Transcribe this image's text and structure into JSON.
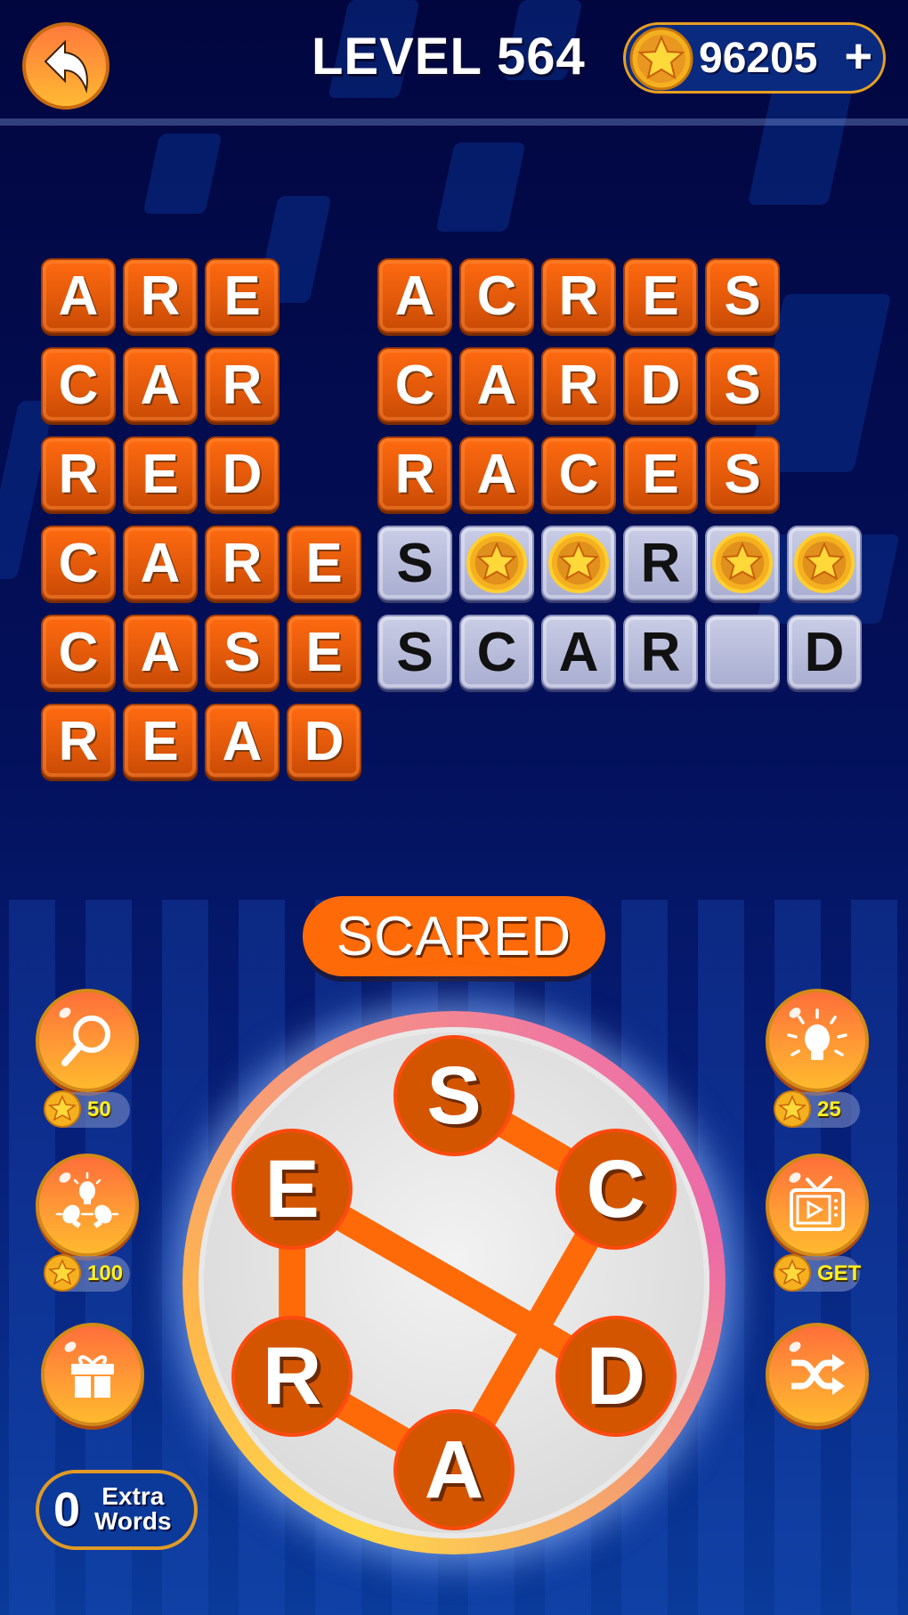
{
  "header": {
    "level_label": "LEVEL 564",
    "coins": "96205",
    "add_coins_symbol": "+",
    "back_icon": "back-arrow-icon"
  },
  "colors": {
    "tile_solved": "#ff6a10",
    "tile_empty": "#bfc3e0",
    "accent_orange": "#ff6a08",
    "coin_gold": "#f5b020",
    "cost_text": "#ffef22",
    "background_dark": "#01063f"
  },
  "board": {
    "left_column": [
      {
        "word": "ARE",
        "letters": [
          "A",
          "R",
          "E"
        ],
        "state": "solved"
      },
      {
        "word": "CAR",
        "letters": [
          "C",
          "A",
          "R"
        ],
        "state": "solved"
      },
      {
        "word": "RED",
        "letters": [
          "R",
          "E",
          "D"
        ],
        "state": "solved"
      },
      {
        "word": "CARE",
        "letters": [
          "C",
          "A",
          "R",
          "E"
        ],
        "state": "solved"
      },
      {
        "word": "CASE",
        "letters": [
          "C",
          "A",
          "S",
          "E"
        ],
        "state": "solved"
      },
      {
        "word": "READ",
        "letters": [
          "R",
          "E",
          "A",
          "D"
        ],
        "state": "solved"
      }
    ],
    "right_column": [
      {
        "word": "ACRES",
        "letters": [
          "A",
          "C",
          "R",
          "E",
          "S"
        ],
        "state": "solved"
      },
      {
        "word": "CARDS",
        "letters": [
          "C",
          "A",
          "R",
          "D",
          "S"
        ],
        "state": "solved"
      },
      {
        "word": "RACES",
        "letters": [
          "R",
          "A",
          "C",
          "E",
          "S"
        ],
        "state": "solved"
      },
      {
        "letters": [
          "S",
          "coin",
          "coin",
          "R",
          "coin",
          "coin"
        ],
        "state": "partial"
      },
      {
        "letters": [
          "S",
          "C",
          "A",
          "R",
          "",
          "D"
        ],
        "state": "partial"
      }
    ]
  },
  "current_word": "SCARED",
  "wheel": {
    "letters": [
      "S",
      "C",
      "D",
      "A",
      "R",
      "E"
    ],
    "selected_path": [
      "S",
      "C",
      "A",
      "R",
      "E",
      "D"
    ]
  },
  "left_buttons": [
    {
      "name": "magnifier-hint",
      "icon": "magnifier-icon",
      "cost": "50"
    },
    {
      "name": "multi-hint",
      "icon": "multi-bulb-icon",
      "cost": "100"
    },
    {
      "name": "gift",
      "icon": "gift-icon"
    }
  ],
  "right_buttons": [
    {
      "name": "bulb-hint",
      "icon": "light-bulb-icon",
      "cost": "25"
    },
    {
      "name": "watch-video",
      "icon": "tv-play-icon",
      "cost": "GET"
    },
    {
      "name": "shuffle",
      "icon": "shuffle-icon"
    }
  ],
  "extra_words": {
    "count": "0",
    "label_line1": "Extra",
    "label_line2": "Words"
  }
}
